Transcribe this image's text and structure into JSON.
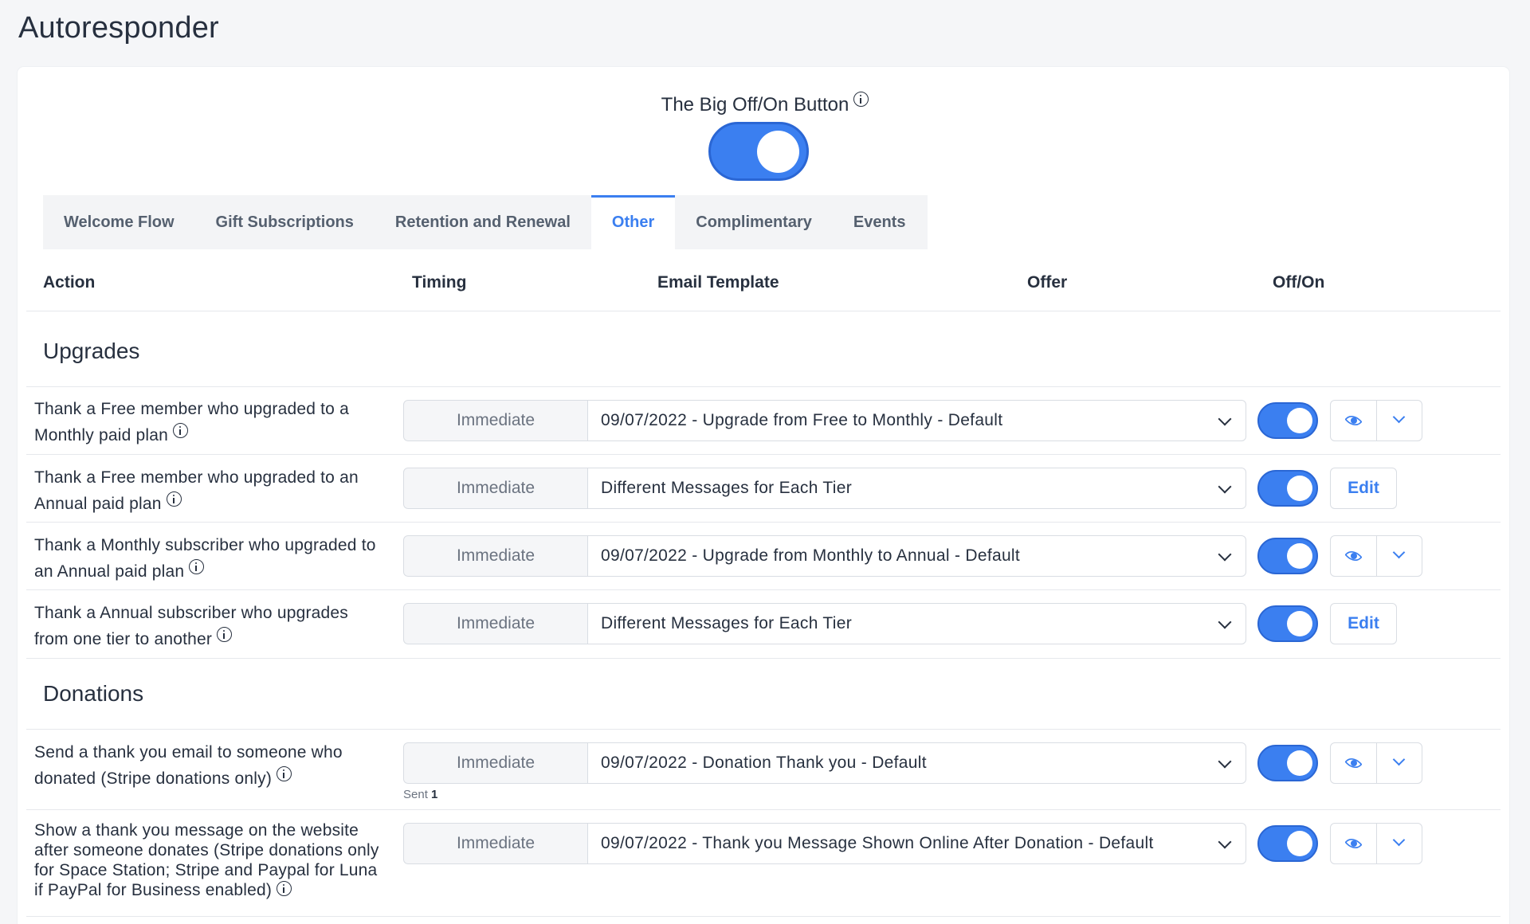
{
  "page": {
    "title": "Autoresponder"
  },
  "master_switch": {
    "label": "The Big Off/On Button",
    "on": true
  },
  "tabs": [
    {
      "label": "Welcome Flow",
      "active": false
    },
    {
      "label": "Gift Subscriptions",
      "active": false
    },
    {
      "label": "Retention and Renewal",
      "active": false
    },
    {
      "label": "Other",
      "active": true
    },
    {
      "label": "Complimentary",
      "active": false
    },
    {
      "label": "Events",
      "active": false
    }
  ],
  "columns": {
    "action": "Action",
    "timing": "Timing",
    "template": "Email Template",
    "offer": "Offer",
    "onoff": "Off/On"
  },
  "sections": [
    {
      "title": "Upgrades",
      "rows": [
        {
          "action": "Thank a Free member who upgraded to a Monthly paid plan",
          "timing": "Immediate",
          "template": "09/07/2022 - Upgrade from Free to Monthly - Default",
          "on": true,
          "controls": "preview"
        },
        {
          "action": "Thank a Free member who upgraded to an Annual paid plan",
          "timing": "Immediate",
          "template": "Different Messages for Each Tier",
          "on": true,
          "controls": "edit",
          "edit_label": "Edit"
        },
        {
          "action": "Thank a Monthly subscriber who upgraded to an Annual paid plan",
          "timing": "Immediate",
          "template": "09/07/2022 - Upgrade from Monthly to Annual - Default",
          "on": true,
          "controls": "preview"
        },
        {
          "action": "Thank a Annual subscriber who upgrades from one tier to another",
          "timing": "Immediate",
          "template": "Different Messages for Each Tier",
          "on": true,
          "controls": "edit",
          "edit_label": "Edit"
        }
      ]
    },
    {
      "title": "Donations",
      "rows": [
        {
          "action": "Send a thank you email to someone who donated (Stripe donations only)",
          "timing": "Immediate",
          "template": "09/07/2022 - Donation Thank you - Default",
          "on": true,
          "controls": "preview",
          "sent_label": "Sent",
          "sent_count": "1"
        },
        {
          "action": "Show a thank you message on the website after someone donates (Stripe donations only for Space Station; Stripe and Paypal for Luna if PayPal for Business enabled)",
          "timing": "Immediate",
          "template": "09/07/2022 - Thank you Message Shown Online After Donation - Default",
          "on": true,
          "controls": "preview"
        }
      ]
    }
  ],
  "colors": {
    "accent": "#3b7ff0",
    "text": "#27303f",
    "muted": "#6b7380",
    "background": "#f5f6f8"
  }
}
